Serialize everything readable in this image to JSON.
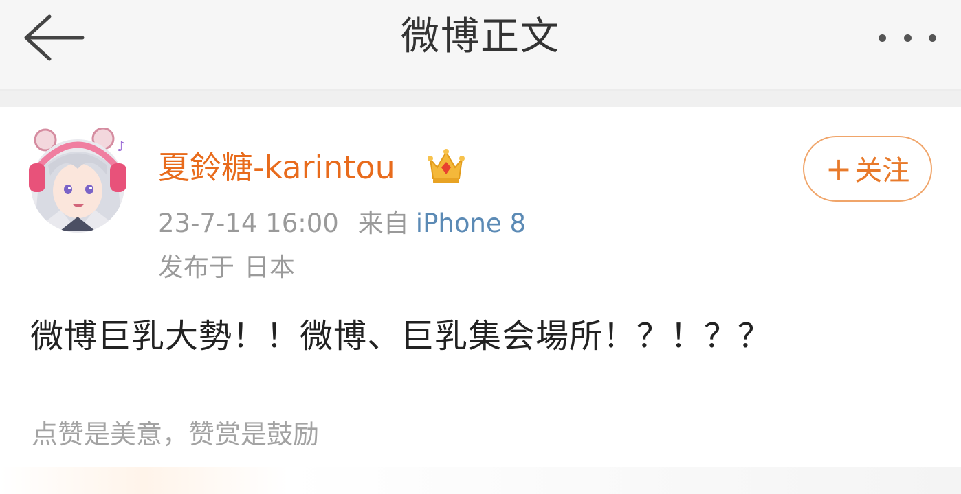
{
  "header": {
    "title": "微博正文",
    "back_icon": "arrow-left-icon",
    "more_icon": "more-dots-icon"
  },
  "post": {
    "author": {
      "name": "夏鈴糖-karintou",
      "badge_icon": "crown-icon"
    },
    "timestamp": "23-7-14 16:00",
    "source_prefix": "来自",
    "source_device": "iPhone 8",
    "location_prefix": "发布于",
    "location_value": "日本",
    "follow_label": "关注",
    "follow_plus": "+",
    "text": "微博巨乳大勢！！微博、巨乳集会場所！？！？？",
    "reward_note": "点赞是美意，赞赏是鼓励"
  },
  "colors": {
    "username": "#e86b1c",
    "source_device": "#5b8ab5",
    "follow_border": "#f0a56a",
    "meta_text": "#9a9a9a"
  }
}
